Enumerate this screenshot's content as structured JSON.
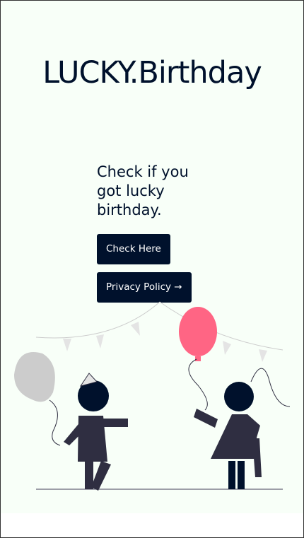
{
  "title": "LUCKY.Birthday",
  "tagline": "Check if you got lucky birthday.",
  "buttons": {
    "check": "Check Here",
    "privacy": "Privacy Policy →"
  },
  "colors": {
    "bg": "#f8fff8",
    "primary": "#00112c",
    "balloon_pink": "#ff6584",
    "balloon_gray": "#cccccc",
    "body": "#2f2e41"
  }
}
